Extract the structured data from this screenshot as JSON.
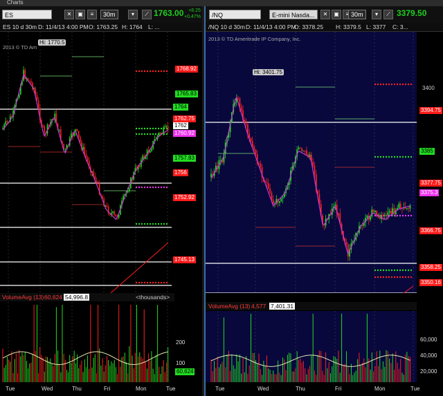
{
  "window": {
    "title": "Charts"
  },
  "left": {
    "symbol": "ES",
    "aggregation": "30m",
    "last": "1763.00",
    "change": "+8.25",
    "change_pct": "+0.47%",
    "info": [
      "ES 10 d 30m",
      "D: 11/4/13 4:00 PM",
      "O: 1763.25",
      "H: 1764",
      "L: ..."
    ],
    "watermark": "2013 © TD Am",
    "hi_label": "Hi: 1770.5",
    "levels": [
      {
        "text": "1768.92",
        "style": "r"
      },
      {
        "text": "1765.83",
        "style": "g"
      },
      {
        "text": "1764",
        "style": "g"
      },
      {
        "text": "1762.75",
        "style": "r"
      },
      {
        "text": "1762",
        "style": "w"
      },
      {
        "text": "1760.92",
        "style": "m"
      },
      {
        "text": "1757.83",
        "style": "g"
      },
      {
        "text": "1756",
        "style": "r"
      },
      {
        "text": "1752.92",
        "style": "r"
      },
      {
        "text": "1745.13",
        "style": "r"
      }
    ],
    "volume": {
      "label": "VolumeAvg (13)",
      "avg": "60,624",
      "value": "54,996.8",
      "units": "<thousands>",
      "ticks": [
        "200",
        "100"
      ],
      "last_badge": "60,624"
    },
    "days": [
      "Tue",
      "Wed",
      "Thu",
      "Fri",
      "Mon",
      "Tue"
    ]
  },
  "right": {
    "symbol": "/NQ",
    "description": "E-mini Nasda...",
    "aggregation": "30m",
    "last": "3379.50",
    "change": "",
    "change_pct": "",
    "info": [
      "/NQ 10 d 30m",
      "D: 11/4/13 4:00 PM",
      "O: 3378.25",
      "H: 3379.5",
      "L: 3377",
      "C: 3..."
    ],
    "watermark": "2013 © TD Ameritrade IP Company, Inc.",
    "hi_label": "Hi: 3401.75",
    "levels": [
      {
        "text": "3400",
        "style": "t"
      },
      {
        "text": "3394.75",
        "style": "r"
      },
      {
        "text": "3385",
        "style": "g"
      },
      {
        "text": "3377.75",
        "style": "r"
      },
      {
        "text": "3375.3",
        "style": "m"
      },
      {
        "text": "3366.75",
        "style": "r"
      },
      {
        "text": "3358.25",
        "style": "r"
      },
      {
        "text": "3350.16",
        "style": "r"
      }
    ],
    "volume": {
      "label": "VolumeAvg (13)",
      "avg": "4,577",
      "value": "7,401.31",
      "ticks": [
        "60,000",
        "40,000",
        "20,000"
      ]
    },
    "days": [
      "Tue",
      "Wed",
      "Thu",
      "Fri",
      "Mon",
      "Tue"
    ]
  }
}
